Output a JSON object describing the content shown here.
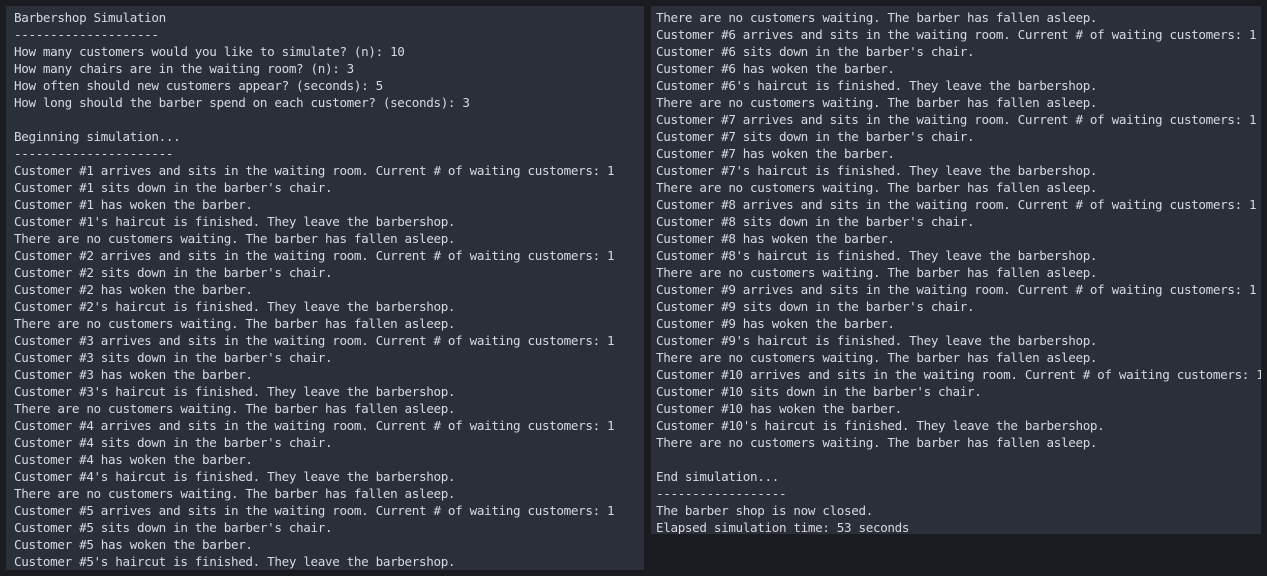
{
  "left_pane": {
    "lines": [
      "Barbershop Simulation",
      "--------------------",
      "How many customers would you like to simulate? (n): 10",
      "How many chairs are in the waiting room? (n): 3",
      "How often should new customers appear? (seconds): 5",
      "How long should the barber spend on each customer? (seconds): 3",
      "",
      "Beginning simulation...",
      "----------------------",
      "Customer #1 arrives and sits in the waiting room. Current # of waiting customers: 1",
      "Customer #1 sits down in the barber's chair.",
      "Customer #1 has woken the barber.",
      "Customer #1's haircut is finished. They leave the barbershop.",
      "There are no customers waiting. The barber has fallen asleep.",
      "Customer #2 arrives and sits in the waiting room. Current # of waiting customers: 1",
      "Customer #2 sits down in the barber's chair.",
      "Customer #2 has woken the barber.",
      "Customer #2's haircut is finished. They leave the barbershop.",
      "There are no customers waiting. The barber has fallen asleep.",
      "Customer #3 arrives and sits in the waiting room. Current # of waiting customers: 1",
      "Customer #3 sits down in the barber's chair.",
      "Customer #3 has woken the barber.",
      "Customer #3's haircut is finished. They leave the barbershop.",
      "There are no customers waiting. The barber has fallen asleep.",
      "Customer #4 arrives and sits in the waiting room. Current # of waiting customers: 1",
      "Customer #4 sits down in the barber's chair.",
      "Customer #4 has woken the barber.",
      "Customer #4's haircut is finished. They leave the barbershop.",
      "There are no customers waiting. The barber has fallen asleep.",
      "Customer #5 arrives and sits in the waiting room. Current # of waiting customers: 1",
      "Customer #5 sits down in the barber's chair.",
      "Customer #5 has woken the barber.",
      "Customer #5's haircut is finished. They leave the barbershop."
    ]
  },
  "right_pane": {
    "lines": [
      "There are no customers waiting. The barber has fallen asleep.",
      "Customer #6 arrives and sits in the waiting room. Current # of waiting customers: 1",
      "Customer #6 sits down in the barber's chair.",
      "Customer #6 has woken the barber.",
      "Customer #6's haircut is finished. They leave the barbershop.",
      "There are no customers waiting. The barber has fallen asleep.",
      "Customer #7 arrives and sits in the waiting room. Current # of waiting customers: 1",
      "Customer #7 sits down in the barber's chair.",
      "Customer #7 has woken the barber.",
      "Customer #7's haircut is finished. They leave the barbershop.",
      "There are no customers waiting. The barber has fallen asleep.",
      "Customer #8 arrives and sits in the waiting room. Current # of waiting customers: 1",
      "Customer #8 sits down in the barber's chair.",
      "Customer #8 has woken the barber.",
      "Customer #8's haircut is finished. They leave the barbershop.",
      "There are no customers waiting. The barber has fallen asleep.",
      "Customer #9 arrives and sits in the waiting room. Current # of waiting customers: 1",
      "Customer #9 sits down in the barber's chair.",
      "Customer #9 has woken the barber.",
      "Customer #9's haircut is finished. They leave the barbershop.",
      "There are no customers waiting. The barber has fallen asleep.",
      "Customer #10 arrives and sits in the waiting room. Current # of waiting customers: 1",
      "Customer #10 sits down in the barber's chair.",
      "Customer #10 has woken the barber.",
      "Customer #10's haircut is finished. They leave the barbershop.",
      "There are no customers waiting. The barber has fallen asleep.",
      "",
      "End simulation...",
      "------------------",
      "The barber shop is now closed.",
      "Elapsed simulation time: 53 seconds"
    ]
  }
}
